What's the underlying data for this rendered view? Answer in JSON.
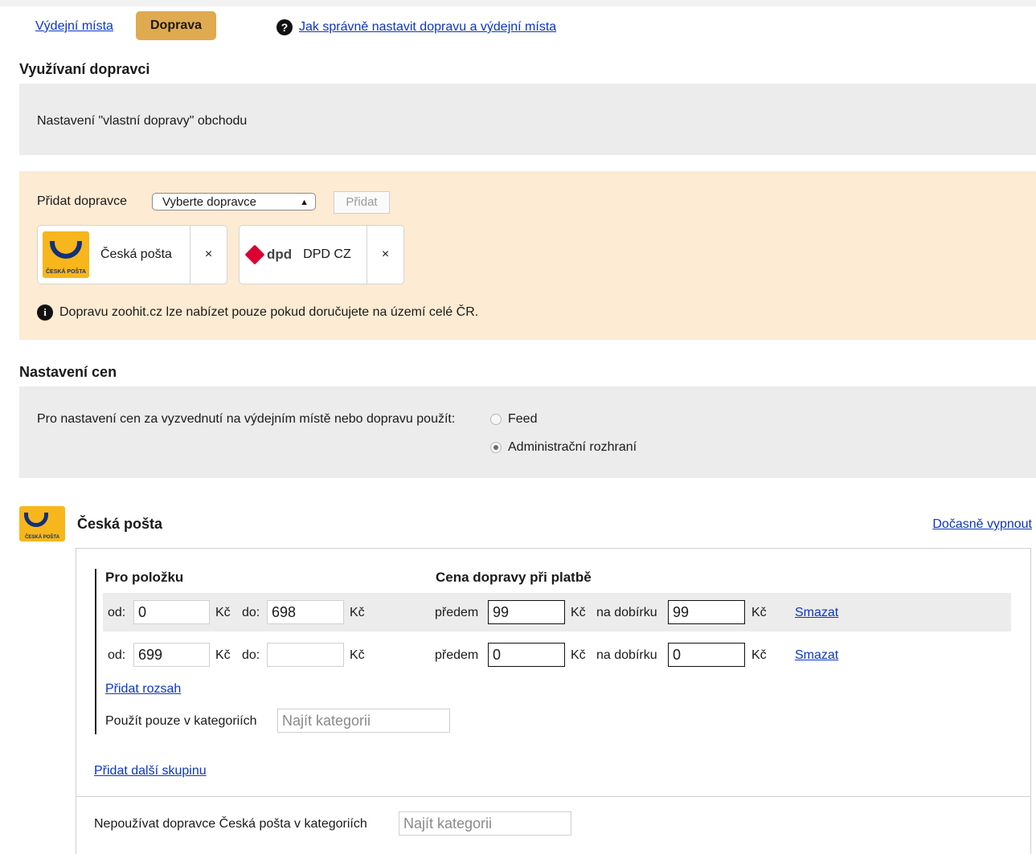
{
  "tabs": {
    "link": "Výdejní místa",
    "active": "Doprava",
    "help_link": "Jak správně nastavit dopravu a výdejní místa",
    "help_icon": "question-icon"
  },
  "sections": {
    "carriers_heading": "Využívaní dopravci",
    "own_shipping": "Nastavení \"vlastní dopravy\" obchodu",
    "prices_heading": "Nastavení cen"
  },
  "add_carrier": {
    "label": "Přidat dopravce",
    "select_value": "Vyberte dopravce",
    "button": "Přidat"
  },
  "carriers": [
    {
      "name": "Česká pošta",
      "close": "×",
      "logo_caption": "ČESKÁ POŠTA"
    },
    {
      "name": "DPD CZ",
      "close": "×",
      "logo_text": "dpd"
    }
  ],
  "info": "Dopravu zoohit.cz lze nabízet pouze pokud doručujete na území celé ČR.",
  "price_source": {
    "label": "Pro nastavení cen za vyzvednutí na výdejním místě nebo dopravu použít:",
    "options": [
      {
        "label": "Feed",
        "selected": false
      },
      {
        "label": "Administrační rozhraní",
        "selected": true
      }
    ]
  },
  "cp_section": {
    "title": "Česká pošta",
    "logo_caption": "ČESKÁ POŠTA",
    "disable_link": "Dočasně vypnout",
    "col_item": "Pro položku",
    "col_price": "Cena dopravy při platbě",
    "labels": {
      "from": "od:",
      "to": "do:",
      "currency": "Kč",
      "prepaid": "předem",
      "cod": "na dobírku",
      "delete": "Smazat"
    },
    "rows": [
      {
        "from": "0",
        "to": "698",
        "prepaid": "99",
        "cod": "99"
      },
      {
        "from": "699",
        "to": "",
        "prepaid": "0",
        "cod": "0"
      }
    ],
    "add_range": "Přidat rozsah",
    "categories_label": "Použít pouze v kategoriích",
    "category_placeholder": "Najít kategorii",
    "add_group": "Přidat další skupinu",
    "exclude_label": "Nepoužívat dopravce Česká pošta v kategoriích",
    "exclude_placeholder": "Najít kategorii"
  }
}
